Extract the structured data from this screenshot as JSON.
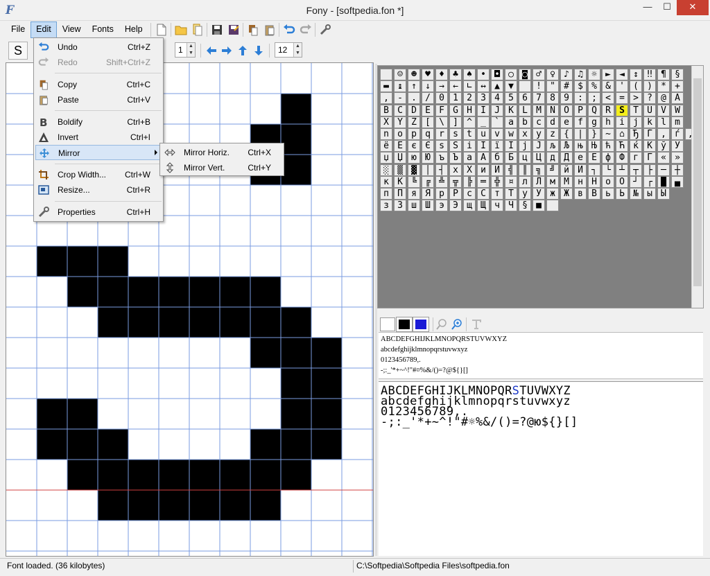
{
  "window": {
    "title": "Fony - [softpedia.fon *]",
    "app_icon": "F",
    "controls": {
      "minimize": "—",
      "maximize": "☐",
      "close": "✕"
    }
  },
  "menubar": [
    "File",
    "Edit",
    "View",
    "Fonts",
    "Help"
  ],
  "toolbar2": {
    "char_preview": "S",
    "spin1_value": "1",
    "spin2_value": "12"
  },
  "edit_menu": {
    "items": [
      {
        "label": "Undo",
        "shortcut": "Ctrl+Z",
        "icon": "undo-icon",
        "enabled": true
      },
      {
        "label": "Redo",
        "shortcut": "Shift+Ctrl+Z",
        "icon": "redo-icon",
        "enabled": false
      },
      {
        "label": "Copy",
        "shortcut": "Ctrl+C",
        "icon": "copy-icon",
        "enabled": true
      },
      {
        "label": "Paste",
        "shortcut": "Ctrl+V",
        "icon": "paste-icon",
        "enabled": true
      },
      {
        "label": "Boldify",
        "shortcut": "Ctrl+B",
        "icon": "bold-icon",
        "enabled": true
      },
      {
        "label": "Invert",
        "shortcut": "Ctrl+I",
        "icon": "invert-icon",
        "enabled": true
      },
      {
        "label": "Mirror",
        "shortcut": "",
        "icon": "mirror-icon",
        "enabled": true
      },
      {
        "label": "Crop Width...",
        "shortcut": "Ctrl+W",
        "icon": "crop-icon",
        "enabled": true
      },
      {
        "label": "Resize...",
        "shortcut": "Ctrl+R",
        "icon": "resize-icon",
        "enabled": true
      },
      {
        "label": "Properties",
        "shortcut": "Ctrl+H",
        "icon": "wrench-icon",
        "enabled": true
      }
    ],
    "mirror_submenu": [
      {
        "label": "Mirror Horiz.",
        "shortcut": "Ctrl+X",
        "icon": "mirror-horiz-icon"
      },
      {
        "label": "Mirror Vert.",
        "shortcut": "Ctrl+Y",
        "icon": "mirror-vert-icon"
      }
    ]
  },
  "glyph_editor": {
    "cell_size": 44,
    "pixels": [
      [
        0,
        0,
        0,
        0,
        0,
        0,
        0,
        0,
        0,
        0,
        0,
        0
      ],
      [
        0,
        0,
        0,
        0,
        0,
        0,
        0,
        0,
        0,
        1,
        0,
        0
      ],
      [
        0,
        0,
        0,
        0,
        0,
        0,
        0,
        0,
        1,
        1,
        0,
        0
      ],
      [
        0,
        0,
        0,
        0,
        0,
        0,
        0,
        0,
        1,
        1,
        0,
        0
      ],
      [
        0,
        0,
        0,
        0,
        0,
        0,
        0,
        0,
        0,
        0,
        0,
        0
      ],
      [
        0,
        0,
        0,
        0,
        0,
        0,
        0,
        0,
        0,
        0,
        0,
        0
      ],
      [
        0,
        1,
        1,
        1,
        0,
        0,
        0,
        0,
        0,
        0,
        0,
        0
      ],
      [
        0,
        0,
        1,
        1,
        1,
        1,
        1,
        1,
        1,
        0,
        0,
        0
      ],
      [
        0,
        0,
        0,
        1,
        1,
        1,
        1,
        1,
        1,
        1,
        0,
        0
      ],
      [
        0,
        0,
        0,
        0,
        0,
        0,
        0,
        0,
        1,
        1,
        1,
        0
      ],
      [
        0,
        0,
        0,
        0,
        0,
        0,
        0,
        0,
        0,
        1,
        1,
        0
      ],
      [
        0,
        1,
        1,
        0,
        0,
        0,
        0,
        0,
        0,
        1,
        1,
        0
      ],
      [
        0,
        1,
        1,
        1,
        0,
        0,
        0,
        0,
        1,
        1,
        1,
        0
      ],
      [
        0,
        0,
        1,
        1,
        1,
        1,
        1,
        1,
        1,
        1,
        0,
        0
      ],
      [
        0,
        0,
        0,
        1,
        1,
        1,
        1,
        1,
        1,
        0,
        0,
        0
      ]
    ],
    "baseline_color": "#d04040",
    "grid_color": "#7a9be0"
  },
  "charmap": {
    "rows": [
      " ☺☻♥♦♣♠•◘○◙♂♀♪♫☼►◄↕‼¶§",
      "▬↨↑↓→←∟↔▲▼ !\"#$%&'()*+",
      ",-./0123456789:;<=>?@A",
      "BCDEFGHIJKLMNOPQRSTUVW",
      "XYZ[\\]^_`abcdefghijklm",
      "nopqrstuvwxyz{|}~⌂ЂЃ‚ѓ„",
      "ёЁєЄѕЅіІїЇјЈљЉњЊћЋќЌўЎ",
      "џЏюЮъЪаАбБцЦдДеЕфФгГ«»",
      "░▒▓│┤хХиИ╣║╗╝йЙ┐└┴┬├─┼",
      "кК╚╔╩╦╠═╬¤лЛмМнНоО┘┌█▄",
      "пПяЯрРсСтТуУжЖвВьЬ№ыЫ",
      "зЗшШэЭщЩчЧ§■ "
    ],
    "selected": "S"
  },
  "preview": {
    "small": [
      "ABCDEFGHIJKLMNOPQRSTUVWXYZ",
      "abcdefghijklmnopqrstuvwxyz",
      "0123456789,.",
      "-;:_'*+~^!\"#¤%&/()=?@${}[]"
    ],
    "large_line1_before": "ABCDEFGHIJKLMNOPQR",
    "large_line1_hl": "S",
    "large_line1_after": "TUVWXYZ",
    "large": [
      "abcdefghijklmnopqrstuvwxyz",
      "0123456789,.",
      "-;:_'*+~^!\"#☼%&/()=?@ю${}[]"
    ]
  },
  "status": {
    "left": "Font loaded. (36 kilobytes)",
    "right": "C:\\Softpedia\\Softpedia Files\\softpedia.fon"
  },
  "colors": {
    "accent": "#1b38c6",
    "selection": "#f4ee1a",
    "menu_highlight": "#d8e6f7"
  }
}
